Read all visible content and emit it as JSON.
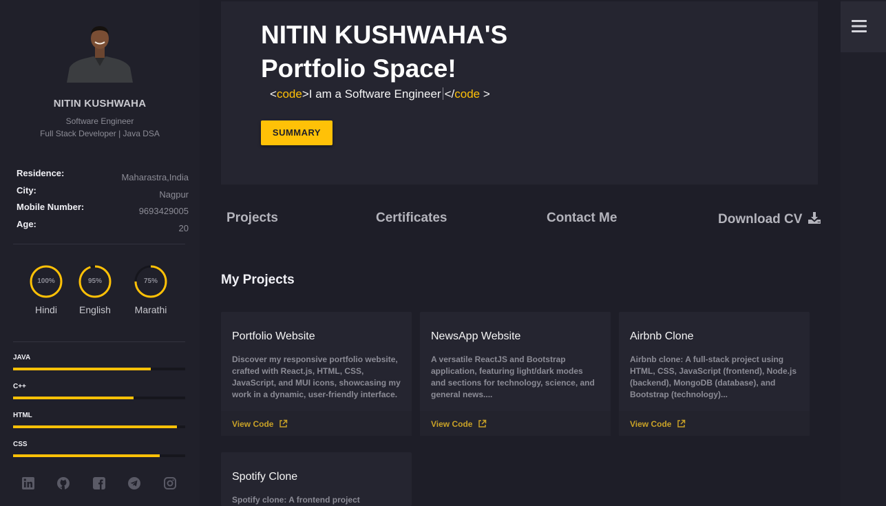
{
  "sidebar": {
    "name": "NITIN KUSHWAHA",
    "role": "Software Engineer",
    "tagline": "Full Stack Developer | Java DSA",
    "info": [
      {
        "label": "Residence:",
        "value": "Maharastra,India"
      },
      {
        "label": "City:",
        "value": "Nagpur"
      },
      {
        "label": "Mobile Number:",
        "value": "9693429005"
      },
      {
        "label": "Age:",
        "value": "20"
      }
    ],
    "languages": [
      {
        "name": "Hindi",
        "percent_text": "100%",
        "percent": 100
      },
      {
        "name": "English",
        "percent_text": "95%",
        "percent": 95
      },
      {
        "name": "Marathi",
        "percent_text": "75%",
        "percent": 75
      }
    ],
    "skills": [
      {
        "name": "JAVA",
        "level": 80
      },
      {
        "name": "C++",
        "level": 70
      },
      {
        "name": "HTML",
        "level": 95
      },
      {
        "name": "CSS",
        "level": 85
      }
    ],
    "socials": [
      "linkedin-icon",
      "github-icon",
      "facebook-icon",
      "telegram-icon",
      "instagram-icon"
    ]
  },
  "hero": {
    "title_line1": "NITIN KUSHWAHA'S",
    "title_line2": "Portfolio Space!",
    "sub_open_lt": "<",
    "sub_open_tag": "code",
    "sub_open_gt": ">",
    "sub_text": "I am a Software Engineer",
    "sub_close_lt": "</",
    "sub_close_tag": "code",
    "sub_close_gt": " >",
    "button": "SUMMARY"
  },
  "nav": {
    "projects": "Projects",
    "certificates": "Certificates",
    "contact": "Contact Me",
    "download": "Download CV"
  },
  "projects": {
    "title": "My Projects",
    "view_code": "View Code",
    "items": [
      {
        "title": "Portfolio Website",
        "desc": "Discover my responsive portfolio website, crafted with React.js, HTML, CSS, JavaScript, and MUI icons, showcasing my work in a dynamic, user-friendly interface."
      },
      {
        "title": "NewsApp Website",
        "desc": "A versatile ReactJS and Bootstrap application, featuring light/dark modes and sections for technology, science, and general news...."
      },
      {
        "title": "Airbnb Clone",
        "desc": "Airbnb clone: A full-stack project using HTML, CSS, JavaScript (frontend), Node.js (backend), MongoDB (database), and Bootstrap (technology)..."
      },
      {
        "title": "Spotify Clone",
        "desc": "Spotify clone: A frontend project"
      }
    ]
  },
  "colors": {
    "accent": "#ffc107",
    "background": "#1e1e28",
    "sidebar": "#20202a",
    "card": "#252530"
  }
}
